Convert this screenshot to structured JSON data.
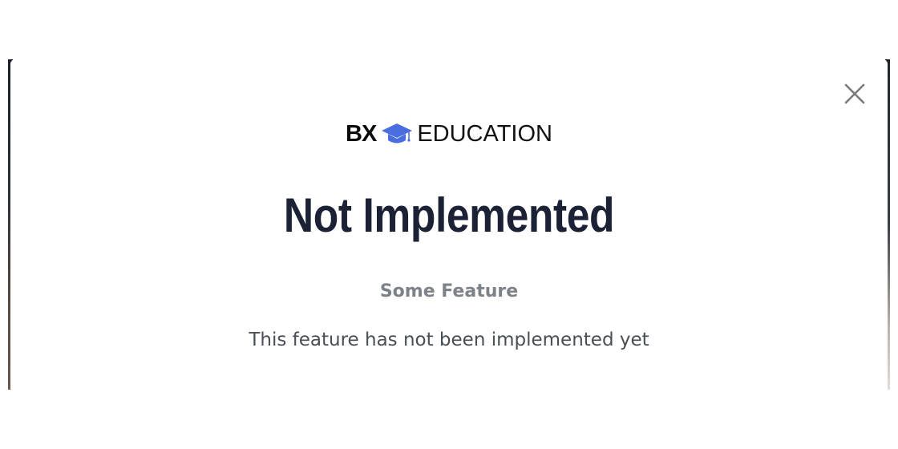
{
  "modal": {
    "brand": {
      "logo_mark": "BX",
      "logo_icon": "graduation-cap-icon",
      "logo_text": "EDUCATION",
      "cap_color": "#4a6ee0"
    },
    "title": "Not Implemented",
    "subtitle": "Some Feature",
    "description": "This feature has not been implemented yet",
    "close_icon": "close-icon"
  }
}
